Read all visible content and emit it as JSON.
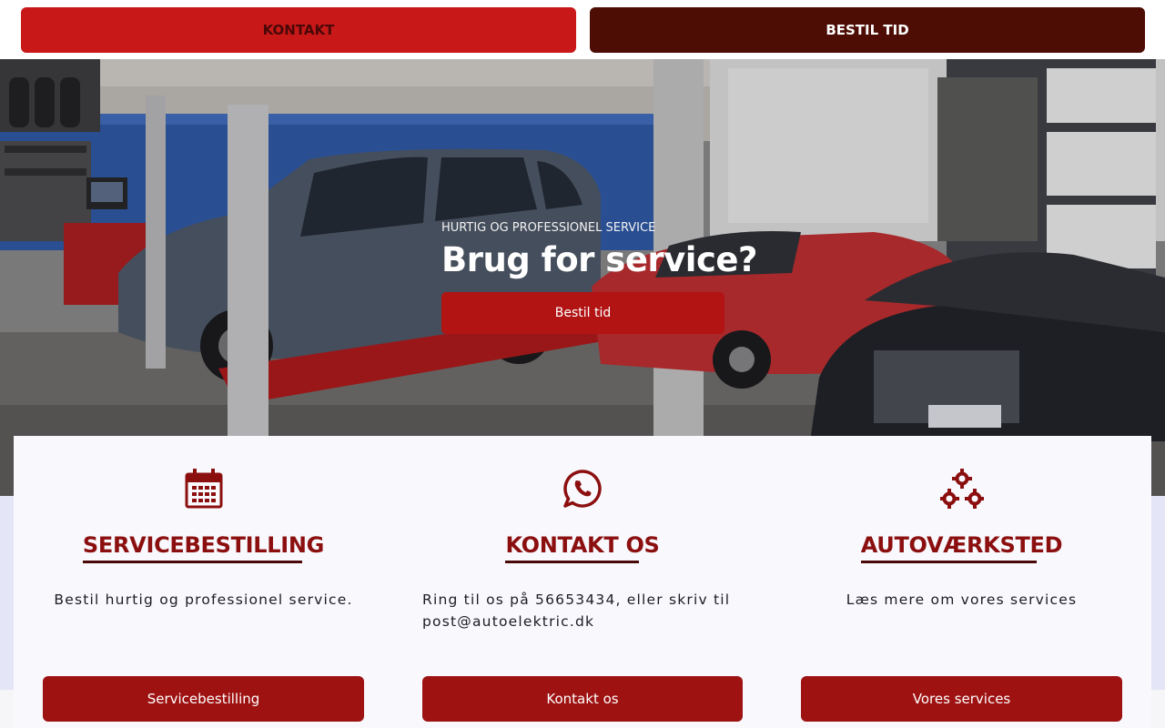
{
  "topbar": {
    "kontakt_label": "KONTAKT",
    "bestil_label": "BESTIL TID"
  },
  "hero": {
    "subtitle": "HURTIG OG PROFESSIONEL SERVICE",
    "title": "Brug for service?",
    "button_label": "Bestil tid"
  },
  "features": [
    {
      "icon": "calendar-icon",
      "title": "SERVICEBESTILLING",
      "text": "Bestil hurtig og professionel service.",
      "button_label": "Servicebestilling"
    },
    {
      "icon": "whatsapp-icon",
      "title": "KONTAKT OS",
      "text": "Ring til os på 56653434, eller skriv til post@autoelektric.dk",
      "button_label": "Kontakt os"
    },
    {
      "icon": "gears-icon",
      "title": "AUTOVÆRKSTED",
      "text": "Læs mere om vores services",
      "button_label": "Vores services"
    }
  ],
  "colors": {
    "brand_red": "#c81818",
    "dark_red": "#4d0c04",
    "accent_red": "#9e1212"
  }
}
